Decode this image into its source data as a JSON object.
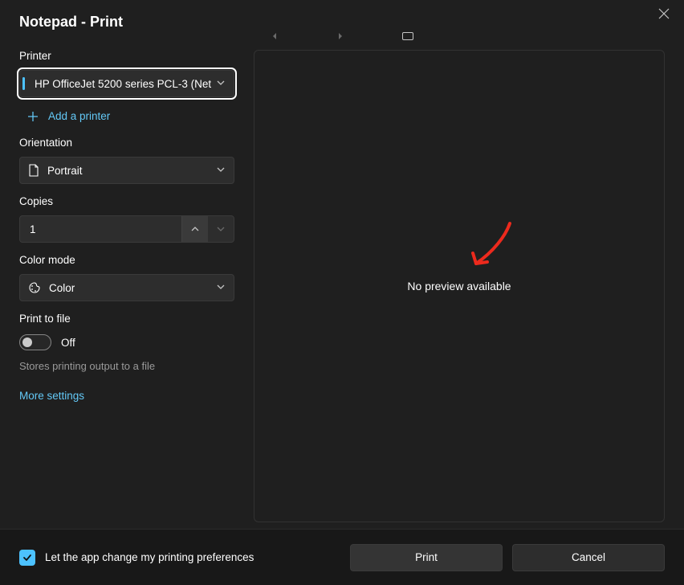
{
  "title": "Notepad - Print",
  "printer": {
    "label": "Printer",
    "selected": "HP OfficeJet 5200 series PCL-3 (Net",
    "add_label": "Add a printer"
  },
  "orientation": {
    "label": "Orientation",
    "selected": "Portrait"
  },
  "copies": {
    "label": "Copies",
    "value": "1"
  },
  "color_mode": {
    "label": "Color mode",
    "selected": "Color"
  },
  "print_to_file": {
    "label": "Print to file",
    "state_label": "Off",
    "help": "Stores printing output to a file"
  },
  "more_settings": "More settings",
  "preview": {
    "message": "No preview available"
  },
  "footer": {
    "checkbox_label": "Let the app change my printing preferences",
    "print": "Print",
    "cancel": "Cancel"
  }
}
